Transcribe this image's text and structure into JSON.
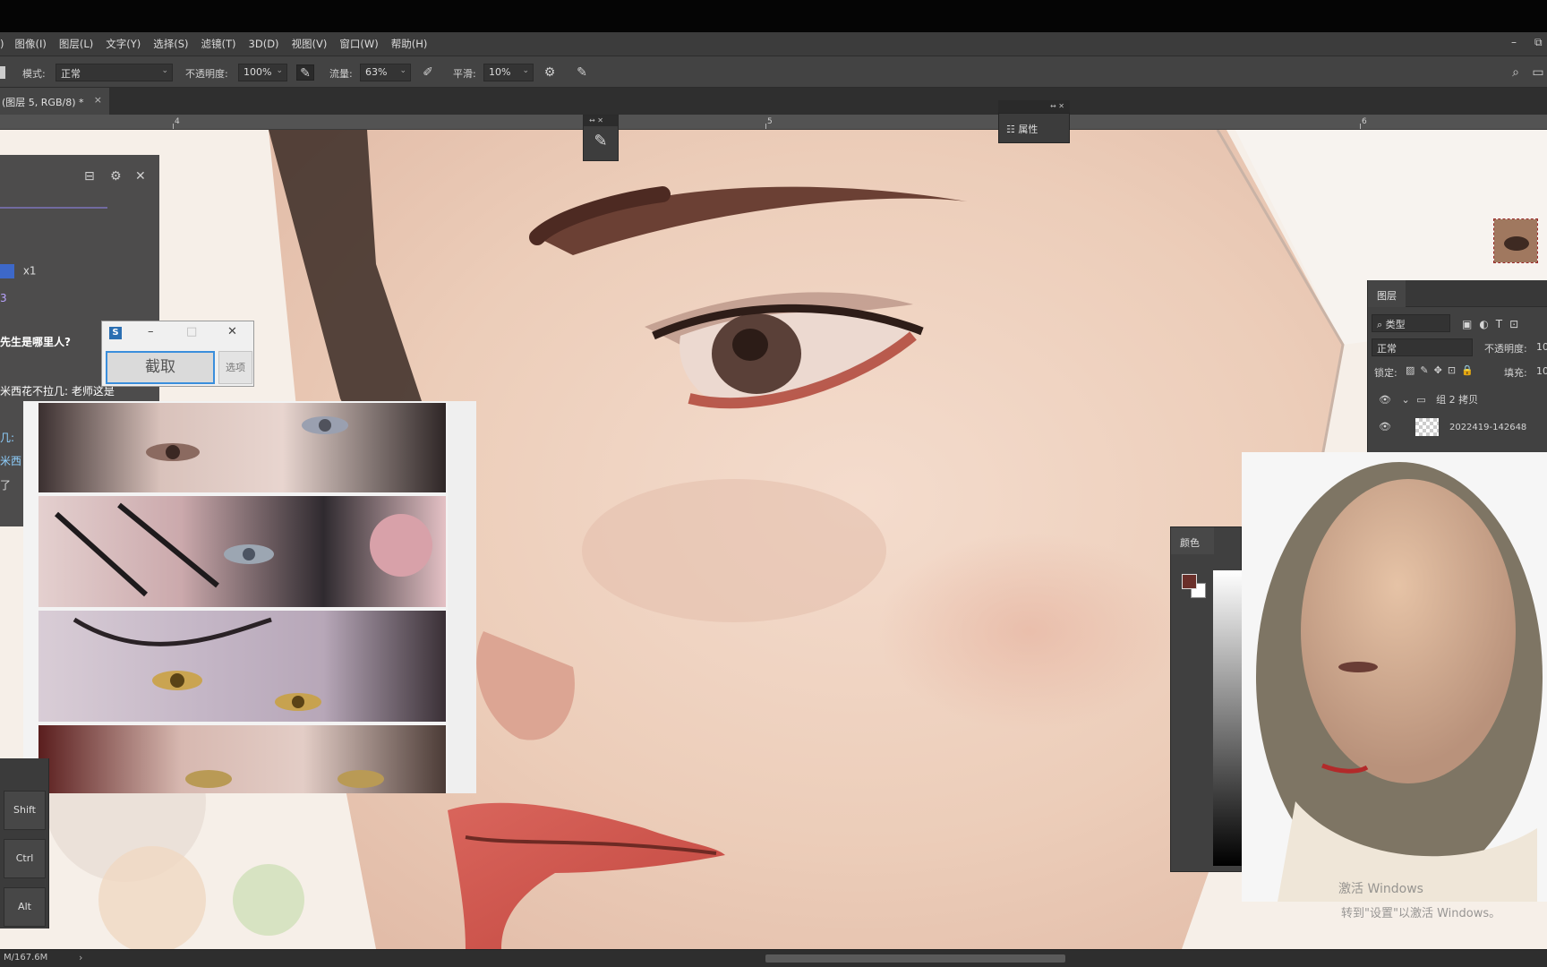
{
  "menu": {
    "leading": ")",
    "items": [
      "图像(I)",
      "图层(L)",
      "文字(Y)",
      "选择(S)",
      "滤镜(T)",
      "3D(D)",
      "视图(V)",
      "窗口(W)",
      "帮助(H)"
    ]
  },
  "window_controls": {
    "minimize": "–",
    "restore": "⧉"
  },
  "options": {
    "mode_label": "模式:",
    "mode_value": "正常",
    "opacity_label": "不透明度:",
    "opacity_value": "100%",
    "flow_label": "流量:",
    "flow_value": "63%",
    "smoothing_label": "平滑:",
    "smoothing_value": "10%"
  },
  "document_tab": {
    "label": "(图层 5, RGB/8) *",
    "close": "×"
  },
  "ruler": {
    "labels": [
      "4",
      "5",
      "6"
    ]
  },
  "floating": {
    "brush_header": "↔ ✕",
    "props_header": "↔ ✕",
    "props_label": "属性"
  },
  "chat": {
    "lines": [
      {
        "text": "x1",
        "color": "#dcdcdc"
      },
      {
        "text": "3",
        "color": "#b9a3ff"
      },
      {
        "text": "先生是哪里人?",
        "color": "#ffffff"
      },
      {
        "text": "米西花不拉几: 老师这是",
        "color": "#ffffff"
      },
      {
        "text": "几:",
        "color": "#8fd0ff"
      },
      {
        "text": "米西",
        "color": "#8fd0ff"
      },
      {
        "text": "了",
        "color": "#dcdcdc"
      }
    ]
  },
  "capture_window": {
    "logo": "S",
    "capture_button": "截取",
    "options_button": "选项",
    "minimize": "–",
    "maximize": "□",
    "close": "✕"
  },
  "shortcut_keys": [
    "Shift",
    "Ctrl",
    "Alt"
  ],
  "layers_panel": {
    "tab": "图层",
    "filter_value": "类型",
    "blend_mode": "正常",
    "opacity_label": "不透明度:",
    "opacity_value": "10",
    "lock_label": "锁定:",
    "fill_label": "填充:",
    "fill_value": "10",
    "layers": [
      {
        "name": "组 2 拷贝",
        "type": "group"
      },
      {
        "name": "2022419-142648",
        "type": "layer"
      }
    ]
  },
  "color_panel": {
    "tab": "颜色",
    "foreground": "#6a2f2a",
    "background": "#ffffff"
  },
  "watermark": {
    "line1": "激活 Windows",
    "line2": "转到\"设置\"以激活 Windows。"
  },
  "status": {
    "doc_size": "M/167.6M"
  }
}
